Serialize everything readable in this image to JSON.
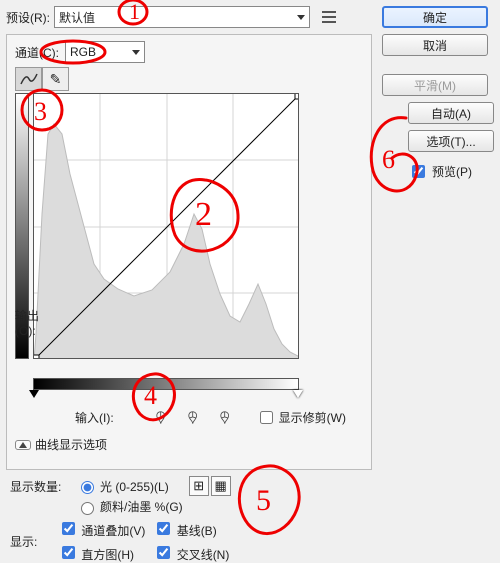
{
  "preset": {
    "label": "预设(R):",
    "value": "默认值"
  },
  "channel": {
    "label": "通道(C):",
    "value": "RGB"
  },
  "output": {
    "label": "输出(O):"
  },
  "input": {
    "label": "输入(I):"
  },
  "showClip": {
    "label": "显示修剪(W)",
    "checked": false
  },
  "curveOptionsToggle": "曲线显示选项",
  "amount": {
    "label": "显示数量:",
    "light": "光 (0-255)(L)",
    "pigment": "颜料/油墨 %(G)",
    "selected": "light"
  },
  "show": {
    "label": "显示:",
    "overlay": "通道叠加(V)",
    "baseline": "基线(B)",
    "histogram": "直方图(H)",
    "intersection": "交叉线(N)"
  },
  "buttons": {
    "ok": "确定",
    "cancel": "取消",
    "smooth": "平滑(M)",
    "auto": "自动(A)",
    "options": "选项(T)..."
  },
  "preview": {
    "label": "预览(P)",
    "checked": true
  },
  "annotations": {
    "1": "1",
    "2": "2",
    "3": "3",
    "4": "4",
    "5": "5",
    "6": "6"
  }
}
